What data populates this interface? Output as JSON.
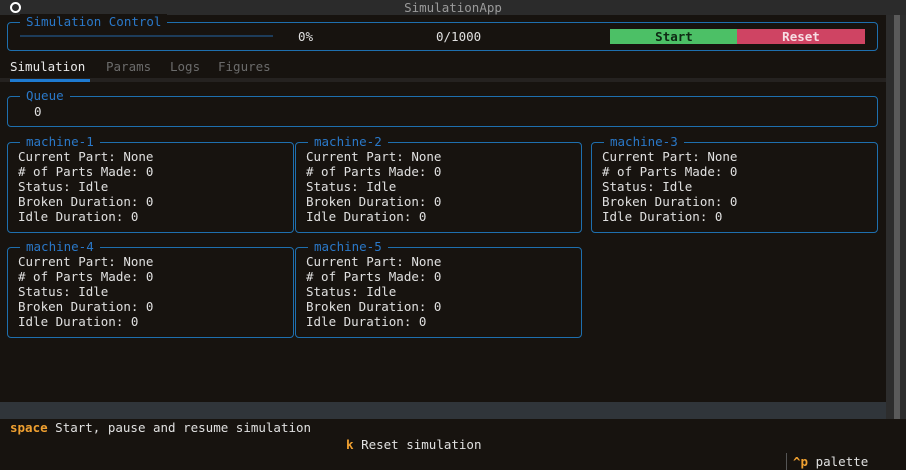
{
  "app": {
    "title": "SimulationApp"
  },
  "control": {
    "legend": "Simulation Control",
    "progress_percent": "0%",
    "progress_value": 0,
    "counter": "0/1000",
    "start_label": "Start",
    "reset_label": "Reset"
  },
  "tabs": [
    {
      "label": "Simulation",
      "active": true
    },
    {
      "label": "Params"
    },
    {
      "label": "Logs"
    },
    {
      "label": "Figures"
    }
  ],
  "queue": {
    "legend": "Queue",
    "value": "0"
  },
  "machines": [
    {
      "name": "machine-1",
      "current_part": "Current Part: None",
      "parts_made": "# of Parts Made: 0",
      "status": "Status: Idle",
      "broken": "Broken Duration: 0",
      "idle": "Idle Duration: 0"
    },
    {
      "name": "machine-2",
      "current_part": "Current Part: None",
      "parts_made": "# of Parts Made: 0",
      "status": "Status: Idle",
      "broken": "Broken Duration: 0",
      "idle": "Idle Duration: 0"
    },
    {
      "name": "machine-3",
      "current_part": "Current Part: None",
      "parts_made": "# of Parts Made: 0",
      "status": "Status: Idle",
      "broken": "Broken Duration: 0",
      "idle": "Idle Duration: 0"
    },
    {
      "name": "machine-4",
      "current_part": "Current Part: None",
      "parts_made": "# of Parts Made: 0",
      "status": "Status: Idle",
      "broken": "Broken Duration: 0",
      "idle": "Idle Duration: 0"
    },
    {
      "name": "machine-5",
      "current_part": "Current Part: None",
      "parts_made": "# of Parts Made: 0",
      "status": "Status: Idle",
      "broken": "Broken Duration: 0",
      "idle": "Idle Duration: 0"
    }
  ],
  "footer": {
    "bindings": [
      {
        "key": "space",
        "desc": "Start, pause and resume simulation"
      },
      {
        "key": "k",
        "desc": "Reset simulation"
      }
    ],
    "palette_key": "^p",
    "palette_label": "palette"
  }
}
